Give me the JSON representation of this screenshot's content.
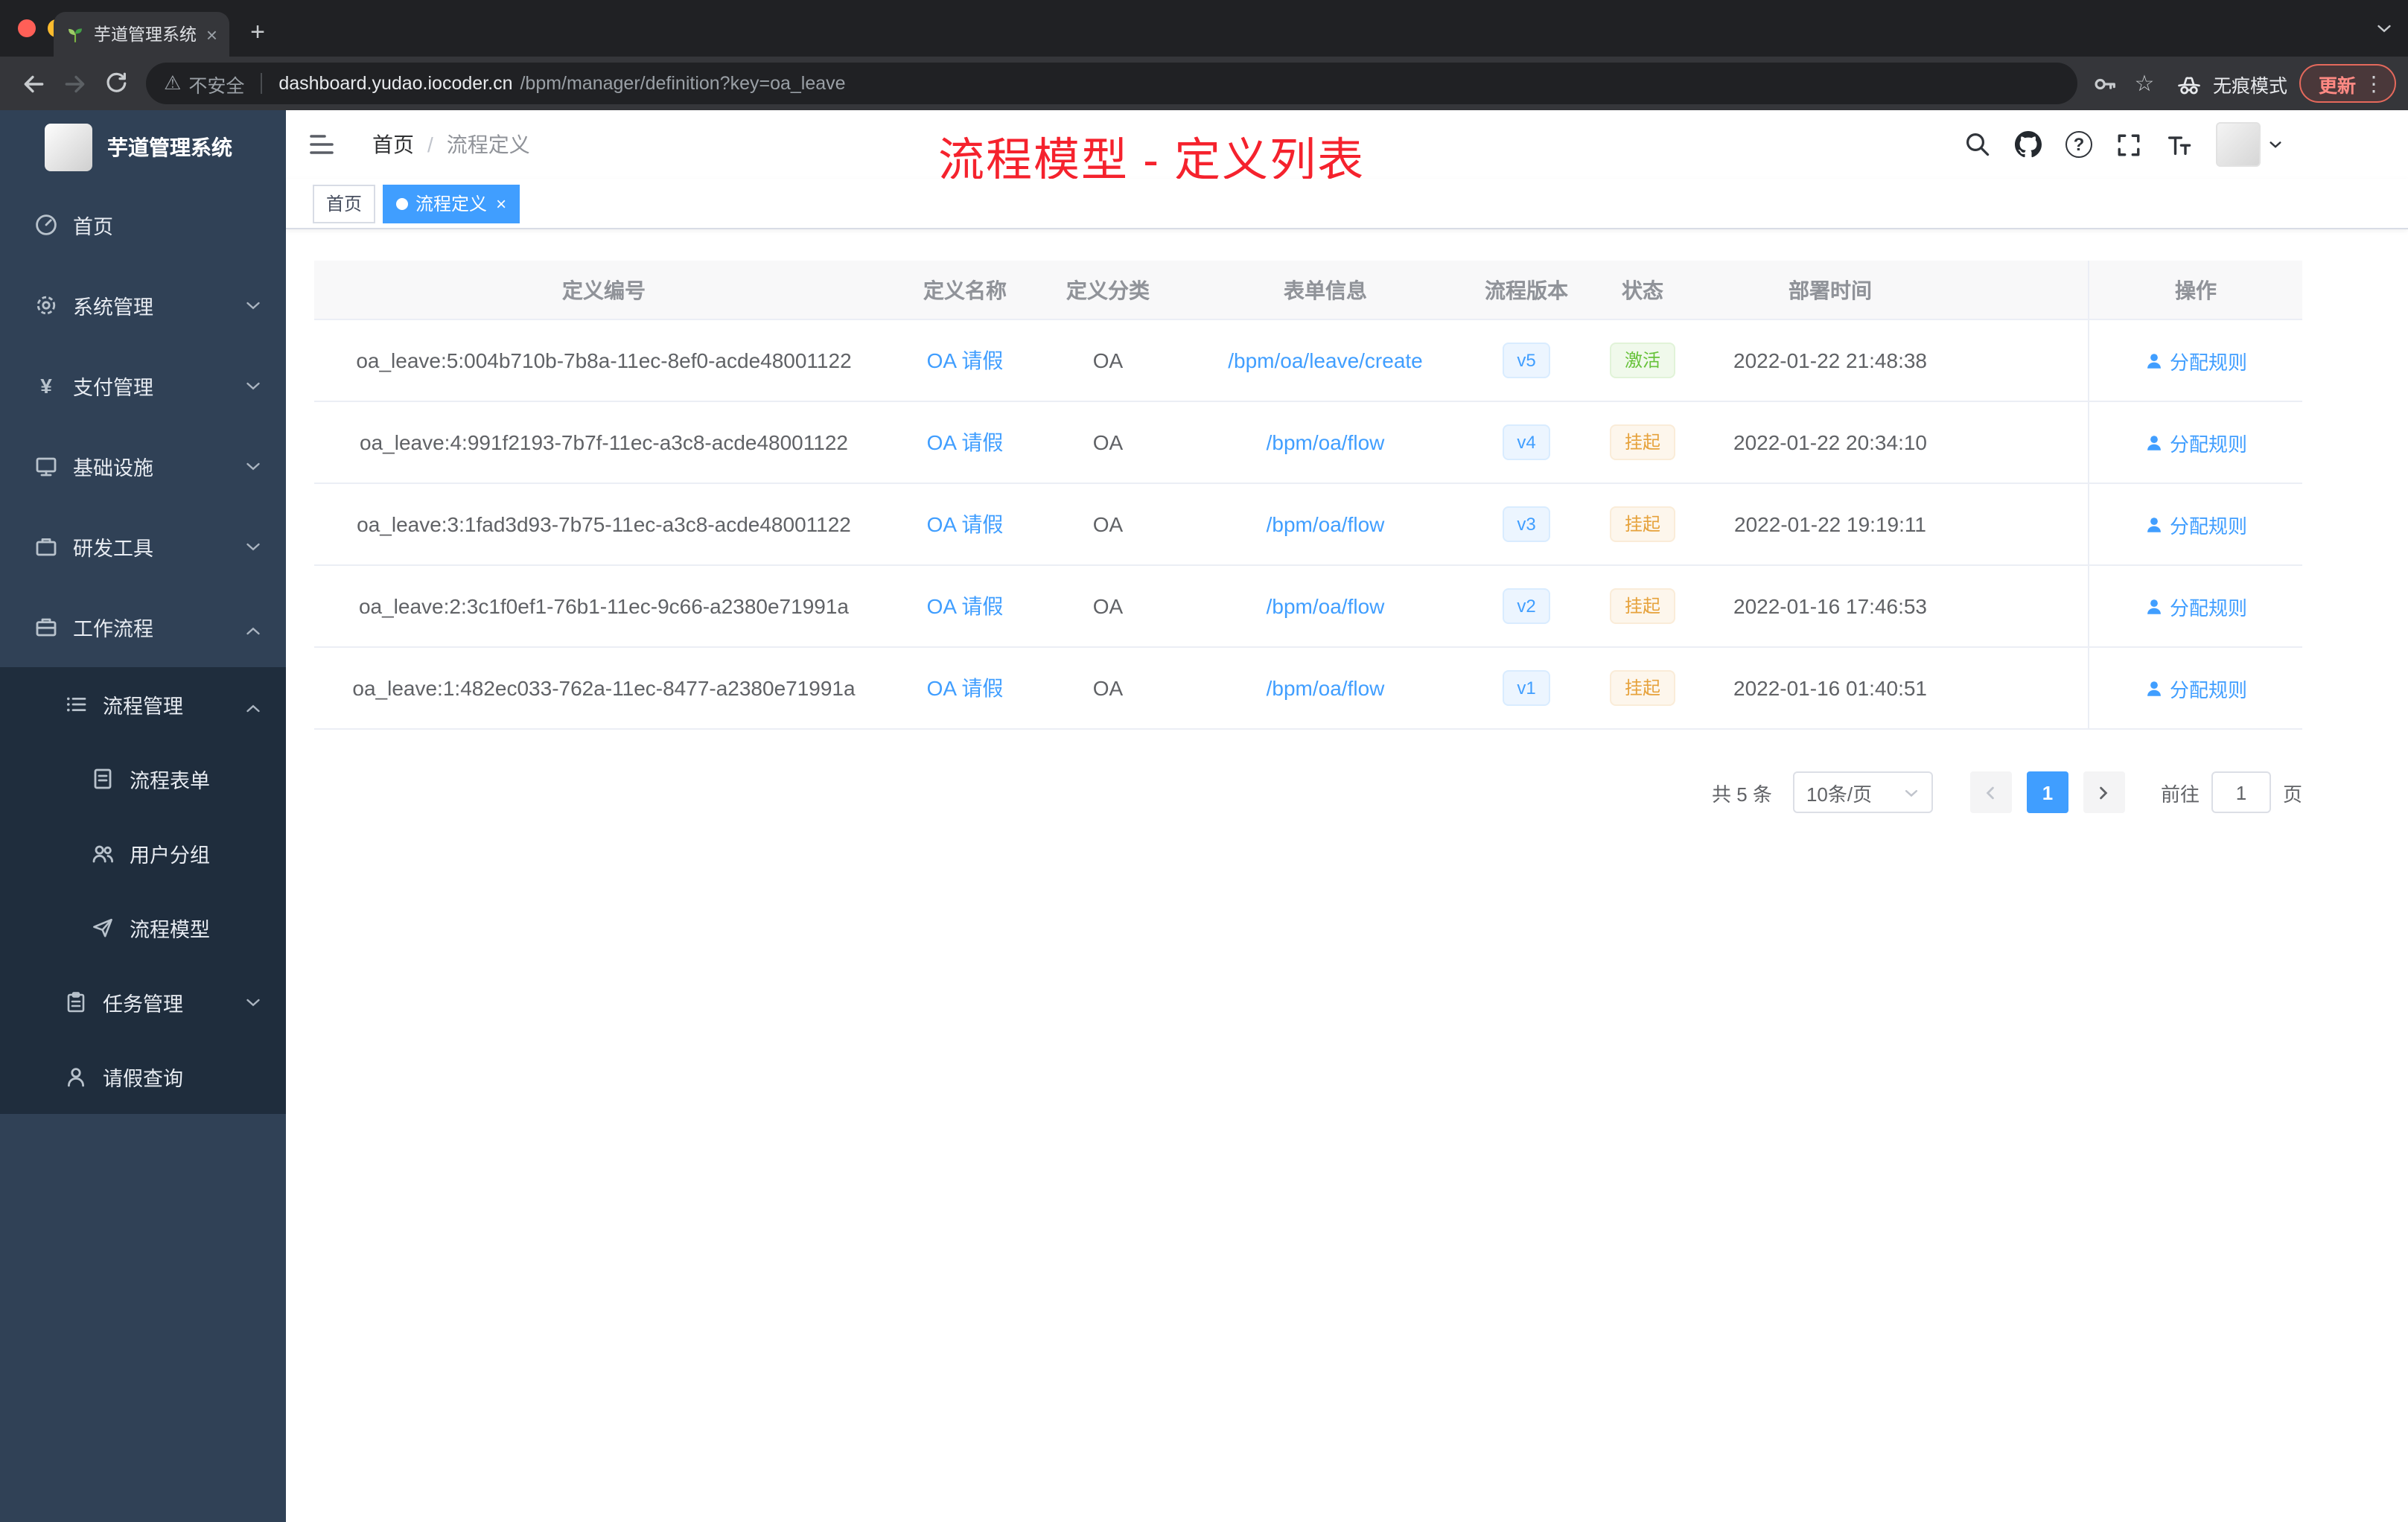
{
  "browser": {
    "tab_title": "芋道管理系统",
    "security_label": "不安全",
    "url_host": "dashboard.yudao.iocoder.cn",
    "url_path": "/bpm/manager/definition?key=oa_leave",
    "incognito_label": "无痕模式",
    "update_label": "更新"
  },
  "sidebar": {
    "logo_title": "芋道管理系统",
    "items": [
      {
        "label": "首页"
      },
      {
        "label": "系统管理"
      },
      {
        "label": "支付管理"
      },
      {
        "label": "基础设施"
      },
      {
        "label": "研发工具"
      },
      {
        "label": "工作流程"
      },
      {
        "label": "流程管理"
      },
      {
        "label": "流程表单"
      },
      {
        "label": "用户分组"
      },
      {
        "label": "流程模型"
      },
      {
        "label": "任务管理"
      },
      {
        "label": "请假查询"
      }
    ]
  },
  "header": {
    "breadcrumb_home": "首页",
    "breadcrumb_sep": "/",
    "breadcrumb_current": "流程定义",
    "annotation": "流程模型 - 定义列表"
  },
  "tags": {
    "home": "首页",
    "active": "流程定义"
  },
  "table": {
    "columns": [
      "定义编号",
      "定义名称",
      "定义分类",
      "表单信息",
      "流程版本",
      "状态",
      "部署时间",
      "操作"
    ],
    "rows": [
      {
        "id": "oa_leave:5:004b710b-7b8a-11ec-8ef0-acde48001122",
        "name": "OA 请假",
        "category": "OA",
        "form": "/bpm/oa/leave/create",
        "version": "v5",
        "status": "激活",
        "time": "2022-01-22 21:48:38",
        "action": "分配规则"
      },
      {
        "id": "oa_leave:4:991f2193-7b7f-11ec-a3c8-acde48001122",
        "name": "OA 请假",
        "category": "OA",
        "form": "/bpm/oa/flow",
        "version": "v4",
        "status": "挂起",
        "time": "2022-01-22 20:34:10",
        "action": "分配规则"
      },
      {
        "id": "oa_leave:3:1fad3d93-7b75-11ec-a3c8-acde48001122",
        "name": "OA 请假",
        "category": "OA",
        "form": "/bpm/oa/flow",
        "version": "v3",
        "status": "挂起",
        "time": "2022-01-22 19:19:11",
        "action": "分配规则"
      },
      {
        "id": "oa_leave:2:3c1f0ef1-76b1-11ec-9c66-a2380e71991a",
        "name": "OA 请假",
        "category": "OA",
        "form": "/bpm/oa/flow",
        "version": "v2",
        "status": "挂起",
        "time": "2022-01-16 17:46:53",
        "action": "分配规则"
      },
      {
        "id": "oa_leave:1:482ec033-762a-11ec-8477-a2380e71991a",
        "name": "OA 请假",
        "category": "OA",
        "form": "/bpm/oa/flow",
        "version": "v1",
        "status": "挂起",
        "time": "2022-01-16 01:40:51",
        "action": "分配规则"
      }
    ]
  },
  "pagination": {
    "total": "共 5 条",
    "page_size": "10条/页",
    "current_page": "1",
    "goto_label": "前往",
    "goto_value": "1",
    "page_label": "页"
  },
  "colors": {
    "accent": "#409eff",
    "success": "#67c23a",
    "warning": "#e6a23c",
    "annotation": "#f5222d",
    "sidebar_bg": "#304156",
    "submenu_bg": "#1f2d3d"
  },
  "icons": {
    "help_glyph": "?",
    "payment_glyph": "¥",
    "warning_glyph": "⚠",
    "star_glyph": "☆",
    "menu_dots_glyph": "⋮",
    "close_glyph": "×",
    "plus_glyph": "+"
  }
}
